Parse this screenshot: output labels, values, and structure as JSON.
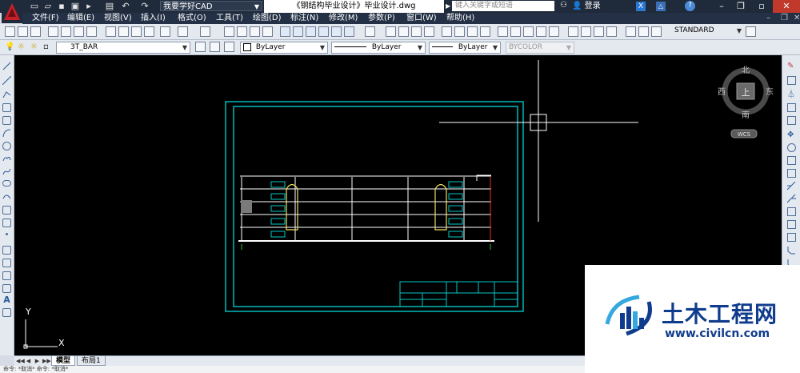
{
  "app": {
    "workspace": "我要学好CAD",
    "document_title": "《钢结构毕业设计》毕业设计.dwg",
    "search_placeholder": "键入关键字或短语",
    "login": "登录"
  },
  "menu": [
    "文件(F)",
    "编辑(E)",
    "视图(V)",
    "插入(I)",
    "格式(O)",
    "工具(T)",
    "绘图(D)",
    "标注(N)",
    "修改(M)",
    "参数(P)",
    "窗口(W)",
    "帮助(H)"
  ],
  "toolbar": {
    "text_style": "STANDARD"
  },
  "properties": {
    "layer": "3T_BAR",
    "color": "ByLayer",
    "linetype": "ByLayer",
    "lineweight": "ByLayer",
    "plotstyle": "BYCOLOR"
  },
  "viewcube": {
    "north": "北",
    "south": "南",
    "east": "东",
    "west": "西",
    "top": "上",
    "wcs": "WCS"
  },
  "ucs": {
    "x": "X",
    "y": "Y"
  },
  "tabs": [
    "模型",
    "布局1"
  ],
  "command_line": "命令: *取消*  命令: *取消*",
  "watermark": {
    "title": "土木工程网",
    "url": "www.civilcn.com"
  },
  "colors": {
    "canvas": "#000000",
    "frame": "#00c8c8",
    "structure": "#ffffff",
    "highlight": "#f0e060",
    "brand": "#0f3c8c"
  }
}
